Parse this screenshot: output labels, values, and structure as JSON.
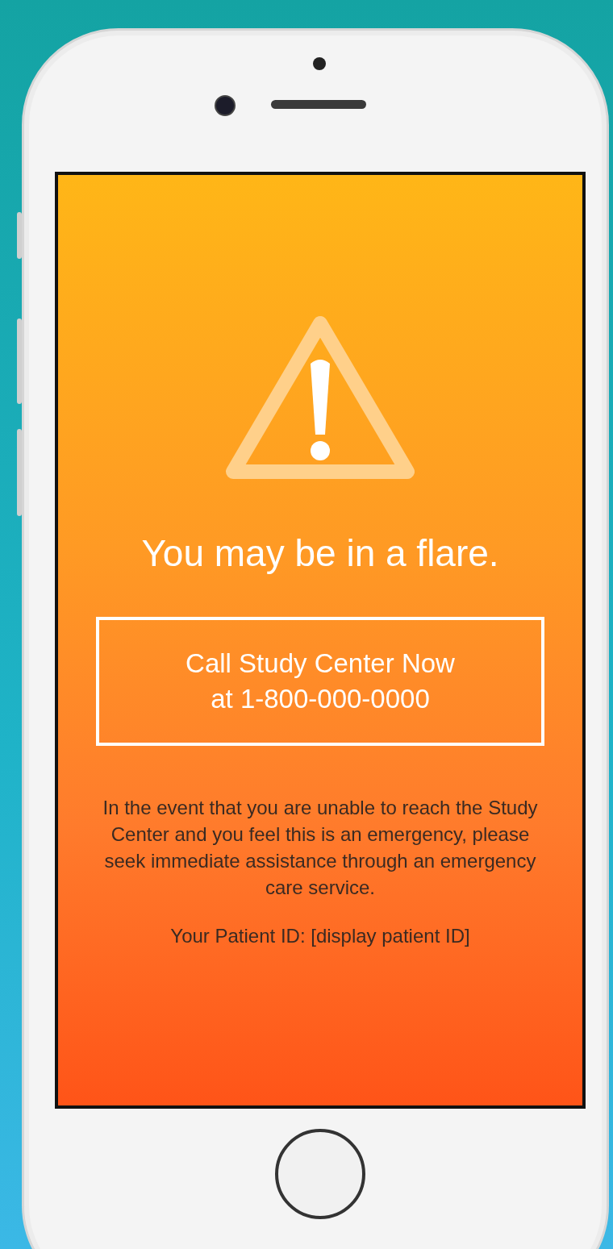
{
  "alert": {
    "title": "You may be in a flare.",
    "call_button": [
      "Call Study Center Now",
      "at 1-800-000-0000"
    ],
    "message": "In the event that you are unable to reach the Study Center and you feel this is an emergency, please seek immediate assistance through an emergency care service.",
    "patient_id": "Your Patient ID: [display patient ID]"
  }
}
